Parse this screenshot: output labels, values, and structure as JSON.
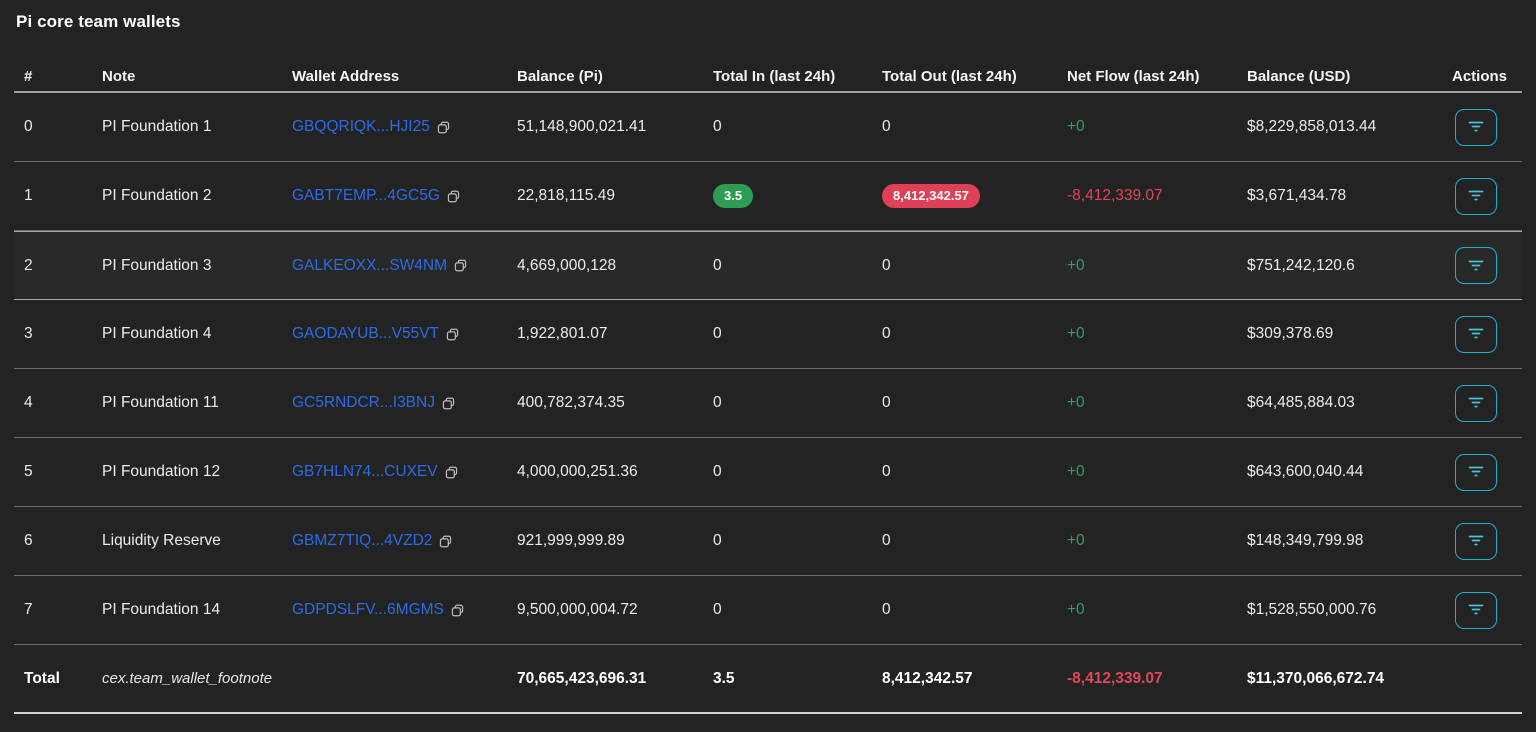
{
  "page": {
    "title": "Pi core team wallets"
  },
  "colors": {
    "background": "#232323",
    "accent_cyan": "#1bafd0",
    "link_blue": "#2c6be6",
    "positive_green": "#2f9e62",
    "negative_red": "#e2465a",
    "badge_green_bg": "#2e9d54",
    "badge_red_bg": "#e04055"
  },
  "icons": {
    "copy": "copy-icon",
    "actions": "filter-icon"
  },
  "table": {
    "columns": [
      {
        "label": "#"
      },
      {
        "label": "Note"
      },
      {
        "label": "Wallet Address"
      },
      {
        "label": "Balance (Pi)"
      },
      {
        "label": "Total In (last 24h)"
      },
      {
        "label": "Total Out (last 24h)"
      },
      {
        "label": "Net Flow (last 24h)"
      },
      {
        "label": "Balance (USD)"
      },
      {
        "label": "Actions"
      }
    ],
    "rows": [
      {
        "index": "0",
        "note": "PI Foundation 1",
        "wallet": "GBQQRIQK...HJI25",
        "balance_pi": "51,148,900,021.41",
        "total_in": "0",
        "total_in_badge": false,
        "total_out": "0",
        "total_out_badge": false,
        "net_flow": "+0",
        "net_flow_color": "green",
        "balance_usd": "$8,229,858,013.44",
        "highlighted": false
      },
      {
        "index": "1",
        "note": "PI Foundation 2",
        "wallet": "GABT7EMP...4GC5G",
        "balance_pi": "22,818,115.49",
        "total_in": "3.5",
        "total_in_badge": true,
        "total_out": "8,412,342.57",
        "total_out_badge": true,
        "net_flow": "-8,412,339.07",
        "net_flow_color": "red",
        "balance_usd": "$3,671,434.78",
        "highlighted": false
      },
      {
        "index": "2",
        "note": "PI Foundation 3",
        "wallet": "GALKEOXX...SW4NM",
        "balance_pi": "4,669,000,128",
        "total_in": "0",
        "total_in_badge": false,
        "total_out": "0",
        "total_out_badge": false,
        "net_flow": "+0",
        "net_flow_color": "green",
        "balance_usd": "$751,242,120.6",
        "highlighted": true
      },
      {
        "index": "3",
        "note": "PI Foundation 4",
        "wallet": "GAODAYUB...V55VT",
        "balance_pi": "1,922,801.07",
        "total_in": "0",
        "total_in_badge": false,
        "total_out": "0",
        "total_out_badge": false,
        "net_flow": "+0",
        "net_flow_color": "green",
        "balance_usd": "$309,378.69",
        "highlighted": false
      },
      {
        "index": "4",
        "note": "PI Foundation 11",
        "wallet": "GC5RNDCR...I3BNJ",
        "balance_pi": "400,782,374.35",
        "total_in": "0",
        "total_in_badge": false,
        "total_out": "0",
        "total_out_badge": false,
        "net_flow": "+0",
        "net_flow_color": "green",
        "balance_usd": "$64,485,884.03",
        "highlighted": false
      },
      {
        "index": "5",
        "note": "PI Foundation 12",
        "wallet": "GB7HLN74...CUXEV",
        "balance_pi": "4,000,000,251.36",
        "total_in": "0",
        "total_in_badge": false,
        "total_out": "0",
        "total_out_badge": false,
        "net_flow": "+0",
        "net_flow_color": "green",
        "balance_usd": "$643,600,040.44",
        "highlighted": false
      },
      {
        "index": "6",
        "note": "Liquidity Reserve",
        "wallet": "GBMZ7TIQ...4VZD2",
        "balance_pi": "921,999,999.89",
        "total_in": "0",
        "total_in_badge": false,
        "total_out": "0",
        "total_out_badge": false,
        "net_flow": "+0",
        "net_flow_color": "green",
        "balance_usd": "$148,349,799.98",
        "highlighted": false
      },
      {
        "index": "7",
        "note": "PI Foundation 14",
        "wallet": "GDPDSLFV...6MGMS",
        "balance_pi": "9,500,000,004.72",
        "total_in": "0",
        "total_in_badge": false,
        "total_out": "0",
        "total_out_badge": false,
        "net_flow": "+0",
        "net_flow_color": "green",
        "balance_usd": "$1,528,550,000.76",
        "highlighted": false
      }
    ],
    "total_row": {
      "label": "Total",
      "footnote": "cex.team_wallet_footnote",
      "balance_pi": "70,665,423,696.31",
      "total_in": "3.5",
      "total_out": "8,412,342.57",
      "net_flow": "-8,412,339.07",
      "balance_usd": "$11,370,066,672.74"
    }
  }
}
